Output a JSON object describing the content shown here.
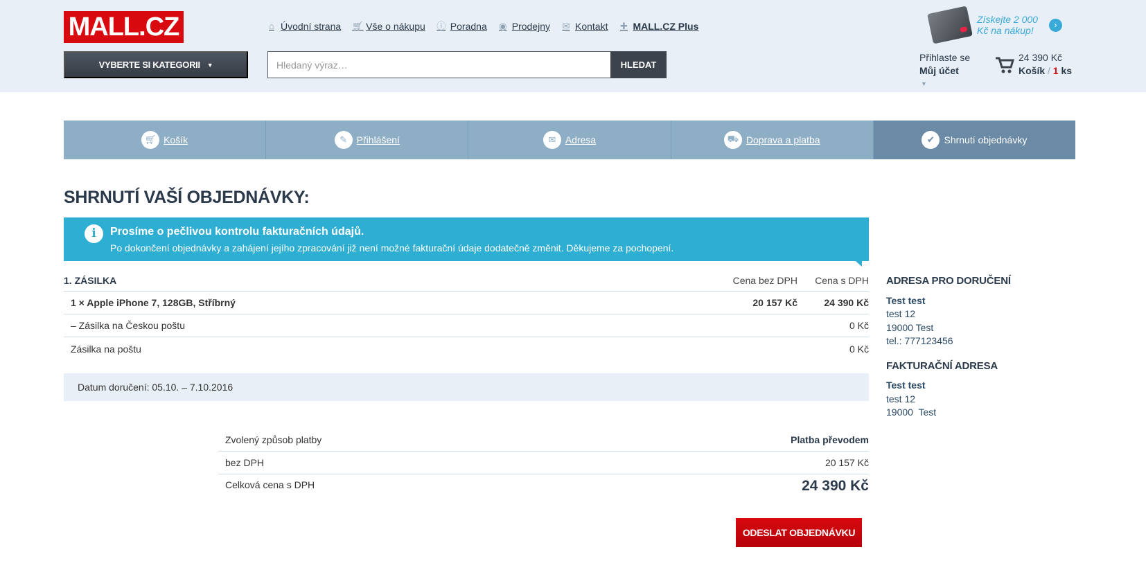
{
  "brand": {
    "logo_text": "MALL.CZ",
    "accent": "#d80a0f"
  },
  "topnav": [
    {
      "label": "Úvodní strana",
      "icon": "home-icon"
    },
    {
      "label": "Vše o nákupu",
      "icon": "cart-icon"
    },
    {
      "label": "Poradna",
      "icon": "info-icon"
    },
    {
      "label": "Prodejny",
      "icon": "store-icon"
    },
    {
      "label": "Kontakt",
      "icon": "mail-icon"
    },
    {
      "label": "MALL.CZ Plus",
      "icon": "plus-icon"
    }
  ],
  "promo": {
    "text": "Získejte 2 000 Kč na nákup!"
  },
  "category_button": "VYBERTE SI KATEGORII",
  "search": {
    "placeholder": "Hledaný výraz…",
    "button": "HLEDAT"
  },
  "account": {
    "line1": "Přihlaste se",
    "line2": "Můj účet"
  },
  "cart": {
    "total": "24 390 Kč",
    "label": "Košík",
    "separator": "/",
    "count": "1",
    "unit": "ks"
  },
  "steps": [
    {
      "label": "Košík",
      "icon": "cart-icon"
    },
    {
      "label": "Přihlášení",
      "icon": "pencil-icon"
    },
    {
      "label": "Adresa",
      "icon": "mail-icon"
    },
    {
      "label": "Doprava a platba",
      "icon": "truck-icon"
    },
    {
      "label": "Shrnutí objednávky",
      "icon": "check-icon"
    }
  ],
  "page_title": "SHRNUTÍ VAŠÍ OBJEDNÁVKY:",
  "info": {
    "title": "Prosíme o pečlivou kontrolu fakturačních údajů.",
    "text": "Po dokončení objednávky a zahájení jejího zpracování již není možné fakturační údaje dodatečně změnit. Děkujeme za pochopení."
  },
  "order": {
    "header": {
      "title": "1. ZÁSILKA",
      "col1": "Cena bez DPH",
      "col2": "Cena s DPH"
    },
    "rows": [
      {
        "desc": "1 × Apple iPhone 7, 128GB, Stříbrný",
        "price_ex": "20 157 Kč",
        "price_in": "24 390 Kč"
      },
      {
        "desc": "– Zásilka na Českou poštu",
        "price_ex": "",
        "price_in": "0 Kč"
      },
      {
        "desc": "Zásilka na poštu",
        "price_ex": "",
        "price_in": "0 Kč"
      }
    ],
    "delivery_date": "Datum doručení: 05.10. – 7.10.2016"
  },
  "summary": {
    "payment_label": "Zvolený způsob platby",
    "payment_value": "Platba převodem",
    "ex_label": "bez DPH",
    "ex_value": "20 157 Kč",
    "total_label": "Celková cena s DPH",
    "total_value": "24 390 Kč"
  },
  "submit_button": "ODESLAT OBJEDNÁVKU",
  "delivery_address": {
    "heading": "ADRESA PRO DORUČENÍ",
    "name": "Test test",
    "street": "test 12",
    "city": "19000 Test",
    "phone": "tel.: 777123456"
  },
  "billing_address": {
    "heading": "FAKTURAČNÍ ADRESA",
    "name": "Test test",
    "street": "test 12",
    "city": "19000  Test"
  }
}
